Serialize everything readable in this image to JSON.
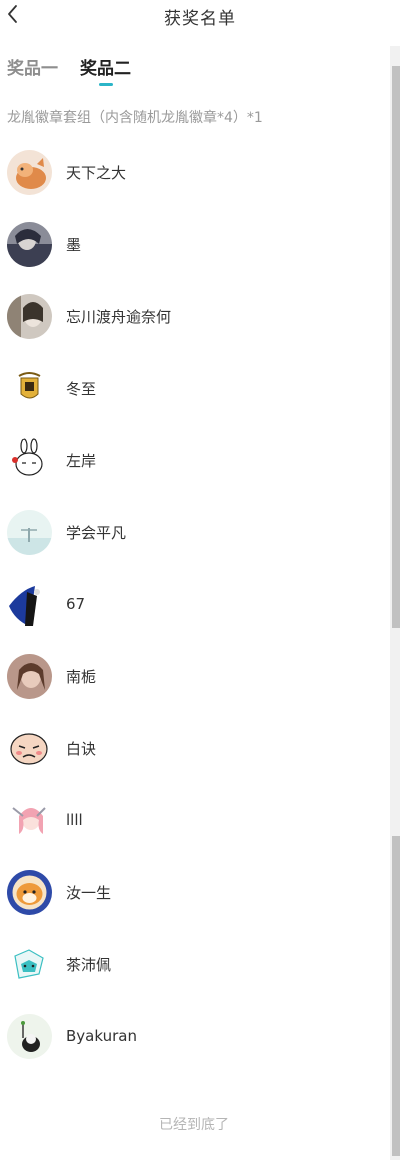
{
  "header": {
    "title": "获奖名单",
    "back_icon": "chevron-left-icon"
  },
  "tabs": [
    {
      "label": "奖品一",
      "active": false
    },
    {
      "label": "奖品二",
      "active": true
    }
  ],
  "prize": {
    "title": "龙胤徽章套组（内含随机龙胤徽章*4）*1"
  },
  "winners": [
    {
      "name": "天下之大"
    },
    {
      "name": "墨"
    },
    {
      "name": "忘川渡舟逾奈何"
    },
    {
      "name": "冬至"
    },
    {
      "name": "左岸"
    },
    {
      "name": "学会平凡"
    },
    {
      "name": "67"
    },
    {
      "name": "南栀"
    },
    {
      "name": "白诀"
    },
    {
      "name": "llll"
    },
    {
      "name": "汝一生"
    },
    {
      "name": "茶沛佩"
    },
    {
      "name": "Byakuran"
    }
  ],
  "footer": {
    "end_text": "已经到底了"
  },
  "colors": {
    "accent": "#2bb5c8",
    "muted": "#9a9a9a"
  }
}
